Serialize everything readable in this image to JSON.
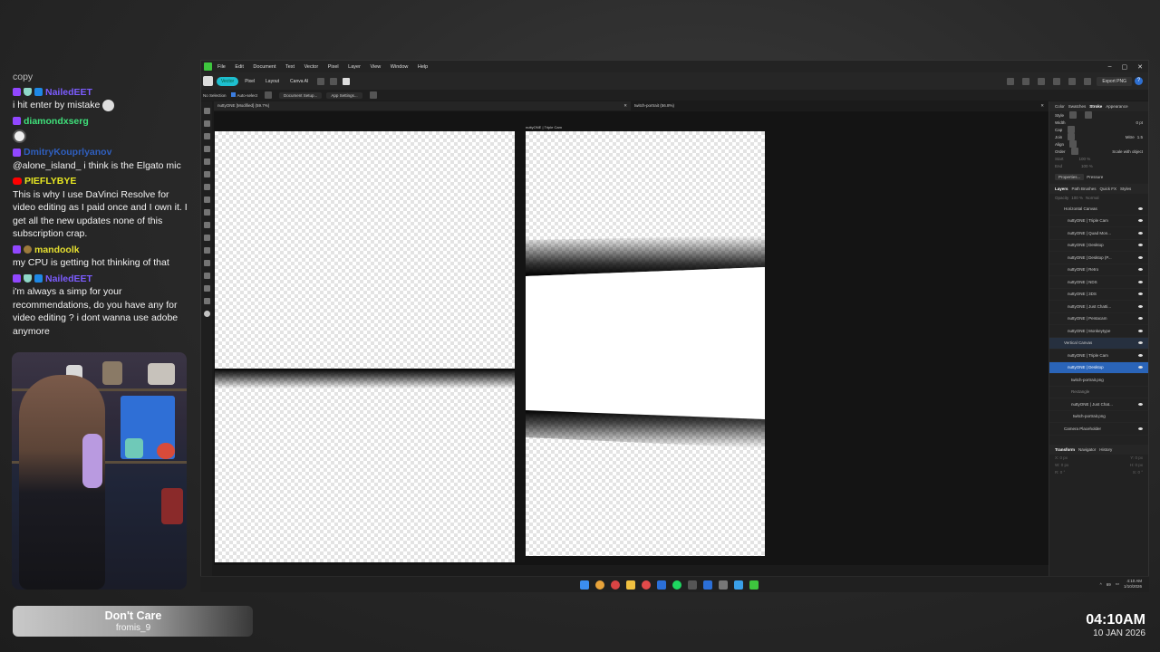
{
  "chat": {
    "header": "copy",
    "messages": [
      {
        "user": "NailedEET",
        "user_color": "#7c5cff",
        "badges": [
          "twitch",
          "shield",
          "blue"
        ],
        "text": "i hit enter by mistake",
        "emote": "face-emote"
      },
      {
        "user": "diamondxserg",
        "user_color": "#3fe07a",
        "badges": [
          "twitch"
        ],
        "text": "",
        "emote": "skull-emote"
      },
      {
        "user": "DmitryKouprlyanov",
        "user_color": "#2f5fbf",
        "badges": [
          "twitch"
        ],
        "text": "@alone_island_ i think is the Elgato mic"
      },
      {
        "user": "PIEFLYBYE",
        "user_color": "#e8e822",
        "badges": [
          "youtube"
        ],
        "text": "This is why I use DaVinci Resolve for video editing as I paid once and I own it. I get all the new updates none of this subscription crap."
      },
      {
        "user": "mandoolk",
        "user_color": "#e6e030",
        "badges": [
          "twitch",
          "avatar"
        ],
        "text": "my CPU is getting hot thinking of that"
      },
      {
        "user": "NailedEET",
        "user_color": "#7c5cff",
        "badges": [
          "twitch",
          "shield",
          "blue"
        ],
        "text": "i'm always a simp for your recommendations, do you have any for video editing ? i dont wanna use adobe anymore"
      }
    ]
  },
  "now_playing": {
    "title": "Don't Care",
    "artist": "fromis_9"
  },
  "clock": {
    "time": "04:10AM",
    "date": "10 JAN 2026"
  },
  "app": {
    "menu": [
      "File",
      "Edit",
      "Document",
      "Text",
      "Vector",
      "Pixel",
      "Layer",
      "View",
      "Window",
      "Help"
    ],
    "personas": [
      "Vector",
      "Pixel",
      "Layout",
      "Canva AI"
    ],
    "export_label": "Export PNG",
    "context": {
      "selection": "No Selection",
      "auto_select": "Auto-select",
      "doc_setup": "Document Setup...",
      "app_settings": "App Settings..."
    },
    "doc_tabs": [
      {
        "name": "nuttyONE [Modified] (59.7%)"
      },
      {
        "name": "twitch-portrait (56.8%)"
      }
    ],
    "artboard2_label": "nuttyONE | Triple Cam",
    "status": {
      "pages": "1 of 15",
      "hint_bold1": "Drag",
      "hint1": "to marquee select.",
      "hint_bold2": "Click",
      "hint2": "an object to select it.",
      "hint_bold3": "Right-Click",
      "hint3": "during marquee select to toggle intersection behavior."
    },
    "panel_tabs_top": [
      "Color",
      "Swatches",
      "Stroke",
      "Appearance"
    ],
    "stroke": {
      "style": "Style",
      "width": "Width",
      "width_val": "0 pt",
      "cap": "Cap",
      "join": "Join",
      "mitre": "Mitre",
      "mitre_val": "1.5",
      "align": "Align",
      "order": "Order",
      "scale": "Scale with object",
      "start": "Start",
      "end": "End",
      "pct1": "100 %",
      "pct2": "100 %"
    },
    "properties": {
      "btn": "Properties...",
      "pressure": "Pressure"
    },
    "panel_tabs_mid": [
      "Layers",
      "Path Brushes",
      "Quick FX",
      "Styles"
    ],
    "layer_opacity": {
      "label": "Opacity",
      "value": "100 %",
      "blend": "Normal"
    },
    "layers": [
      {
        "name": "Horizontal Canvas",
        "kind": "group"
      },
      {
        "name": "nuttyONE | Triple Cam",
        "kind": "item"
      },
      {
        "name": "nuttyONE | Quad Mon...",
        "kind": "item"
      },
      {
        "name": "nuttyONE | Desktop",
        "kind": "item"
      },
      {
        "name": "nuttyONE | Desktop (P...",
        "kind": "item"
      },
      {
        "name": "nuttyONE | Retro",
        "kind": "item"
      },
      {
        "name": "nuttyONE | NDS",
        "kind": "item"
      },
      {
        "name": "nuttyONE | 3DS",
        "kind": "item"
      },
      {
        "name": "nuttyONE | Just Chatti...",
        "kind": "item"
      },
      {
        "name": "nuttyONE | Pentacam",
        "kind": "item"
      },
      {
        "name": "nuttyONE | Monkeytype",
        "kind": "item"
      },
      {
        "name": "Vertical Canvas",
        "kind": "group"
      },
      {
        "name": "nuttyONE | Triple Cam",
        "kind": "item"
      },
      {
        "name": "nuttyONE | Desktop",
        "kind": "selected"
      },
      {
        "name": "twitch-portrait.png",
        "kind": "indent"
      },
      {
        "name": "Rectangle",
        "kind": "dim"
      },
      {
        "name": "nuttyONE | Just Chat...",
        "kind": "indent"
      },
      {
        "name": "twitch-portrait.png",
        "kind": "indent2"
      },
      {
        "name": "Camera Placeholder",
        "kind": "group"
      }
    ],
    "panel_tabs_bottom": [
      "Transform",
      "Navigator",
      "History"
    ],
    "transform": {
      "x": "X:",
      "xv": "0 px",
      "y": "Y:",
      "yv": "0 px",
      "w": "W:",
      "wv": "0 px",
      "h": "H:",
      "hv": "0 px",
      "r": "R:",
      "rv": "0 °",
      "s": "S:",
      "sv": "0 °"
    }
  },
  "tray": {
    "time": "4:10 AM",
    "date": "1/10/2026",
    "count": "69"
  }
}
